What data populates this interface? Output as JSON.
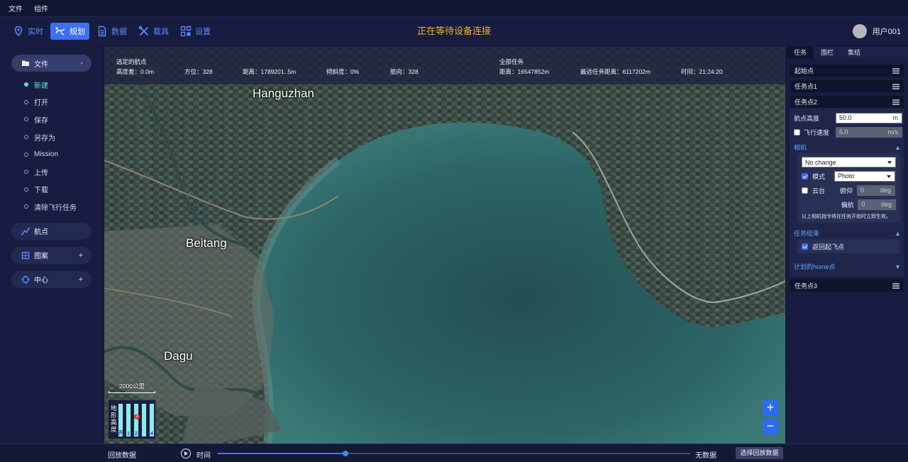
{
  "menubar": {
    "items": [
      "文件",
      "组件"
    ]
  },
  "toolbar": {
    "buttons": [
      {
        "label": "实时",
        "icon": "location-pin-icon",
        "active": false
      },
      {
        "label": "规划",
        "icon": "drone-plan-icon",
        "active": true
      },
      {
        "label": "数据",
        "icon": "document-icon",
        "active": false
      },
      {
        "label": "载具",
        "icon": "tools-icon",
        "active": false
      },
      {
        "label": "设置",
        "icon": "grid-settings-icon",
        "active": false
      }
    ],
    "status": "正在等待设备连接",
    "user": "用户001"
  },
  "sidebar": {
    "file_group": {
      "label": "文件",
      "toggle": "-"
    },
    "file_items": [
      "新建",
      "打开",
      "保存",
      "另存为",
      "Mission",
      "上传",
      "下载",
      "清除飞行任务"
    ],
    "waypoint_group": {
      "label": "航点"
    },
    "pattern_group": {
      "label": "图案",
      "toggle": "+"
    },
    "center_group": {
      "label": "中心",
      "toggle": "+"
    }
  },
  "map": {
    "selected_waypoint": {
      "title": "选定的航点",
      "height_diff": "高度差：0.0m",
      "azimuth": "方位：328",
      "distance": "距离：1789201..5m",
      "gradient": "倾斜度：0%",
      "heading": "航向：328"
    },
    "all_tasks": {
      "title": "全部任务",
      "distance": "距离：16547852m",
      "nearest_distance": "最远任务距离：6117202m",
      "time": "时间：21:24:20"
    },
    "places": [
      "Hanguzhan",
      "Beitang",
      "Dagu"
    ],
    "scale_label": "2000公里",
    "terrain": {
      "label": "地形高度",
      "columns": [
        "开",
        "1",
        "2",
        "4"
      ],
      "marker": "3"
    },
    "zoom_in": "+",
    "zoom_out": "−",
    "colors": {
      "land": "#4d5a45",
      "sea": "#2f6a6b"
    }
  },
  "panel": {
    "tabs": [
      "任务",
      "围栏",
      "集结"
    ],
    "start_point": "起始点",
    "task1": "任务点1",
    "task2": "任务点2",
    "altitude_label": "航点高度",
    "altitude_value": "50.0",
    "altitude_unit": "m",
    "speed_label": "飞行速度",
    "speed_value": "5.0",
    "speed_unit": "m/s",
    "camera_section": "相机",
    "camera_select": "No change",
    "mode_label": "模式",
    "mode_select": "Photo",
    "gimbal_label": "云台",
    "pitch_label": "俯仰",
    "pitch_value": "0",
    "pitch_unit": "deg",
    "yaw_label": "偏航",
    "yaw_value": "0",
    "yaw_unit": "deg",
    "note": "以上相机指令将在任务开始时立即生效。",
    "end_section": "任务结束",
    "return_label": "返回起飞点",
    "home_section": "计划的home点",
    "task3": "任务点3"
  },
  "bottom": {
    "playback": "回放数据",
    "time_label": "时间",
    "progress": 0.27,
    "no_data": "无数据",
    "choose_button": "选择回放数据"
  }
}
